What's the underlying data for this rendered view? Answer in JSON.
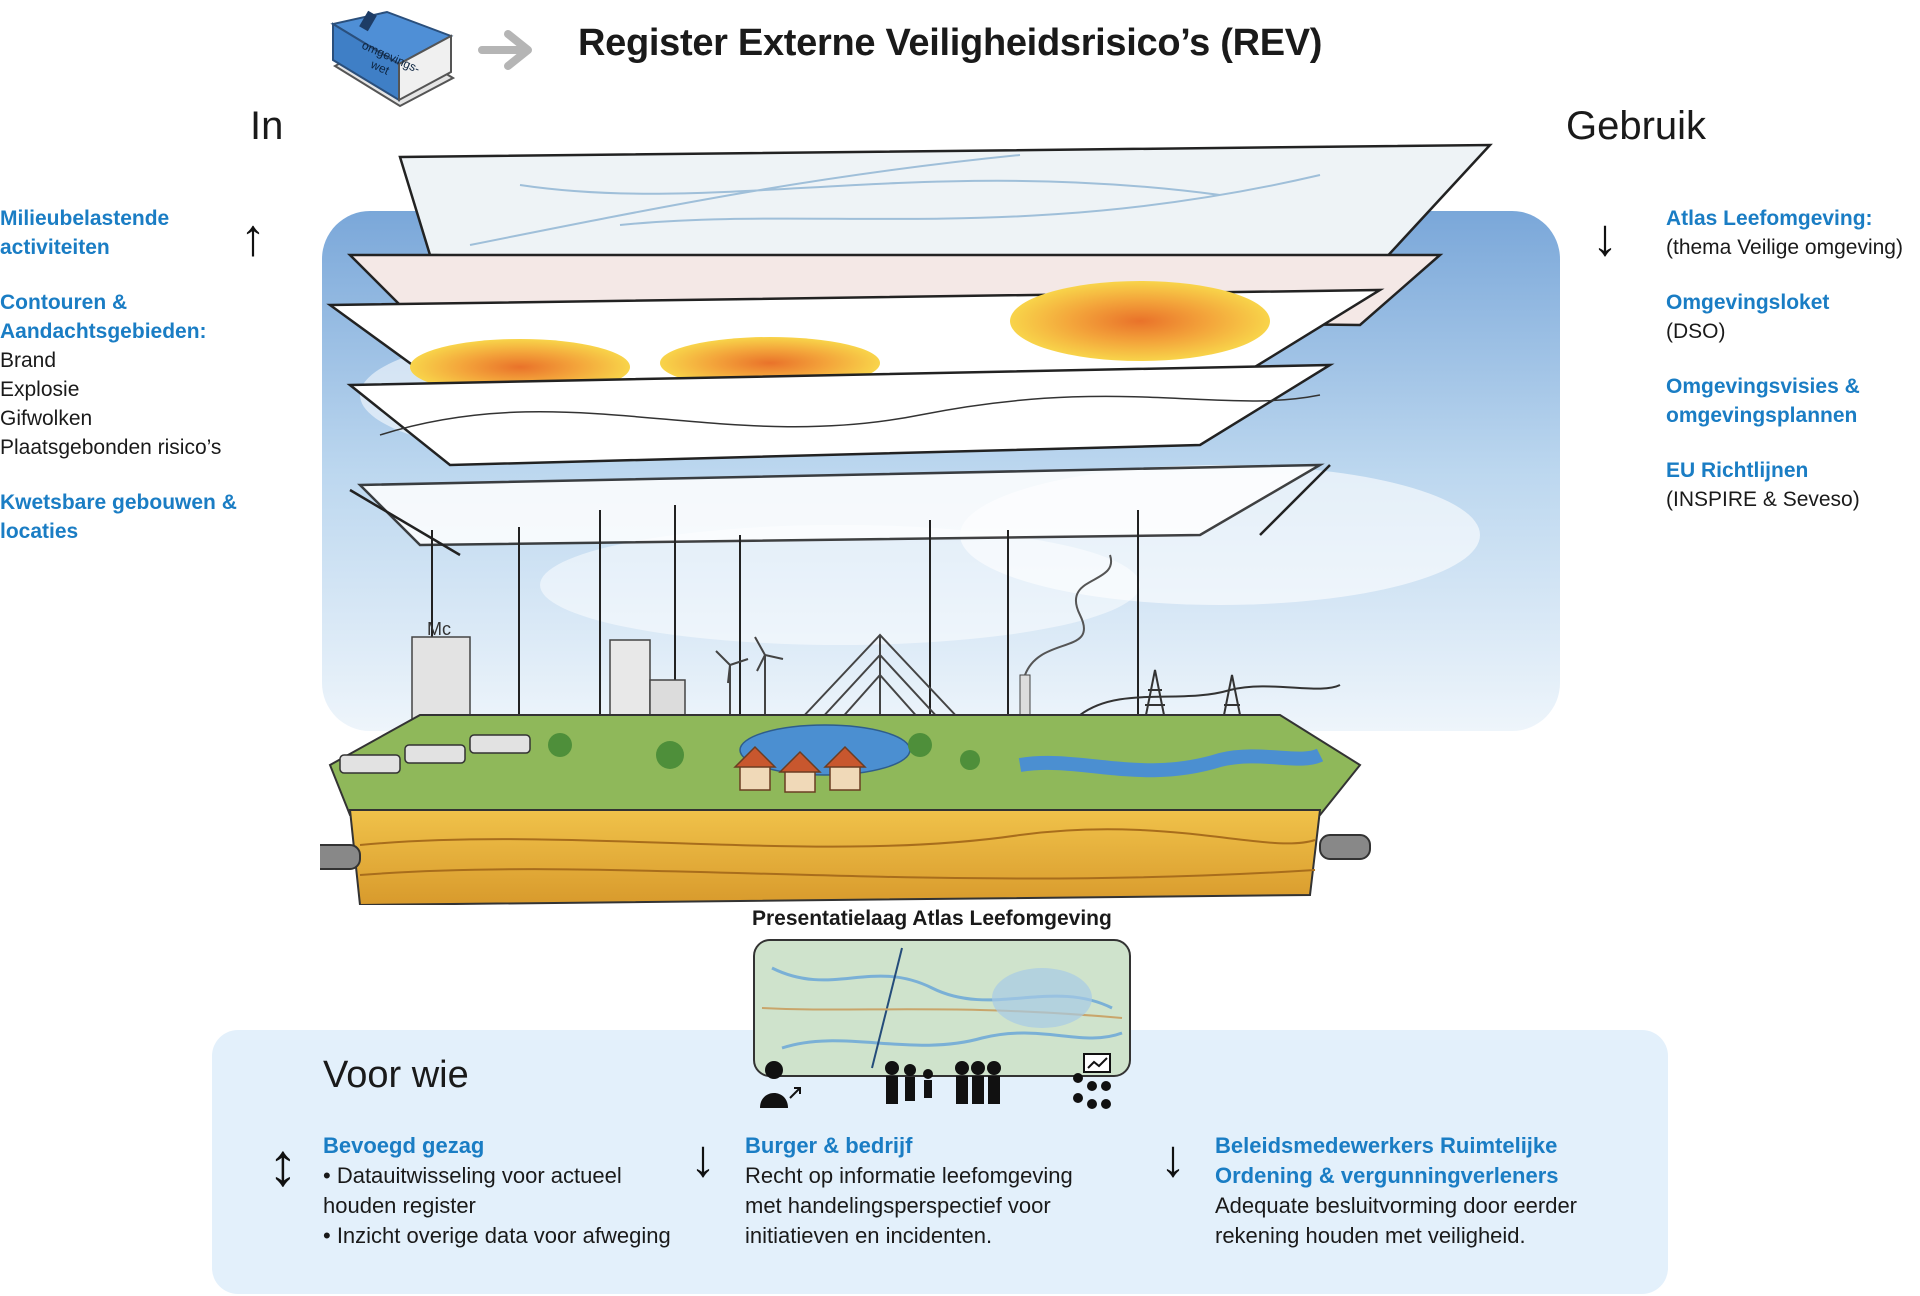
{
  "header": {
    "book_label": "omgevings-\nwet",
    "title": "Register Externe Veiligheidsrisico’s (REV)"
  },
  "left": {
    "heading": "In",
    "groups": [
      {
        "title": "Milieubelastende activiteiten",
        "lines": []
      },
      {
        "title": "Contouren & Aandachtsgebieden:",
        "lines": [
          "Brand",
          "Explosie",
          "Gifwolken",
          "Plaatsgebonden risico’s"
        ]
      },
      {
        "title": "Kwetsbare gebouwen & locaties",
        "lines": []
      }
    ]
  },
  "right": {
    "heading": "Gebruik",
    "groups": [
      {
        "title": "Atlas Leefomgeving:",
        "sub": "(thema Veilige omgeving)"
      },
      {
        "title": "Omgevingsloket",
        "sub": "(DSO)"
      },
      {
        "title": "Omgevingsvisies & omgevingsplannen",
        "sub": ""
      },
      {
        "title": "EU Richtlijnen",
        "sub": "(INSPIRE & Seveso)"
      }
    ]
  },
  "scene": {
    "building_sign": "Mc"
  },
  "presentation": {
    "label": "Presentatielaag Atlas Leefomgeving"
  },
  "audience": {
    "heading": "Voor wie",
    "blocks": [
      {
        "title": "Bevoegd gezag",
        "lines": [
          "• Datauitwisseling voor actueel",
          "houden register",
          "• Inzicht overige data voor afweging"
        ],
        "arrow": "↕"
      },
      {
        "title": "Burger & bedrijf",
        "lines": [
          "Recht op informatie leefomgeving",
          "met handelingsperspectief voor",
          "initiatieven en incidenten."
        ],
        "arrow": "↓"
      },
      {
        "title_lines": [
          "Beleidsmedewerkers Ruimtelijke",
          "Ordening & vergunningverleners"
        ],
        "lines": [
          "Adequate besluitvorming door eerder",
          "rekening houden met veiligheid."
        ],
        "arrow": "↓"
      }
    ]
  },
  "colors": {
    "accent_blue": "#1a7dc4",
    "panel_bg": "#e3f0fb",
    "risk_orange": "#ef7f2d",
    "risk_yellow": "#f6c533",
    "soil": "#e8b441"
  }
}
